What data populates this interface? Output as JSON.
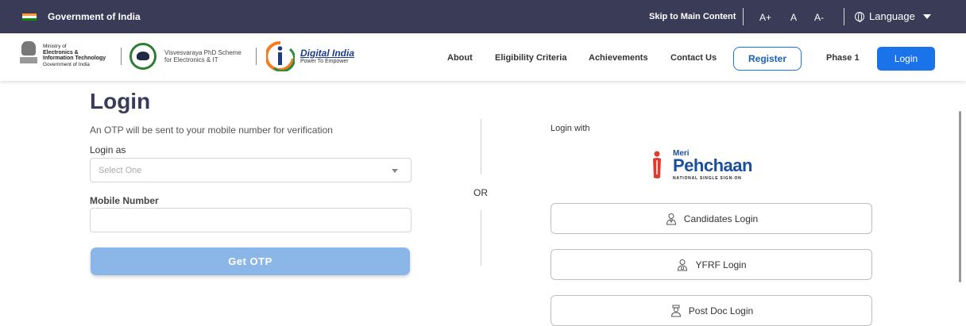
{
  "govbar": {
    "title": "Government of India",
    "skip": "Skip to Main Content",
    "font_plus": "A+",
    "font_normal": "A",
    "font_minus": "A-",
    "language": "Language"
  },
  "header": {
    "ministry_line1": "Ministry of",
    "ministry_line2": "Electronics &",
    "ministry_line3": "Information Technology",
    "ministry_line4": "Government of India",
    "scheme_line1": "Visvesvaraya PhD Scheme",
    "scheme_line2": "for Electronics & IT",
    "digital_title": "Digital India",
    "digital_tagline": "Power To Empower",
    "nav": [
      "About",
      "Eligibility Criteria",
      "Achievements",
      "Contact Us"
    ],
    "register": "Register",
    "phase": "Phase 1",
    "login": "Login"
  },
  "form": {
    "title": "Login",
    "otp_note": "An OTP will be sent to your mobile number for verification",
    "login_as_label": "Login as",
    "login_as_placeholder": "Select One",
    "mobile_label": "Mobile Number",
    "mobile_value": "",
    "get_otp": "Get OTP",
    "or": "OR"
  },
  "sso": {
    "login_with": "Login with",
    "brand_meri": "Meri",
    "brand_pehchaan": "Pehchaan",
    "brand_tagline": "NATIONAL SINGLE SIGN-ON",
    "buttons": [
      {
        "label": "Candidates Login",
        "icon": "candidate-icon"
      },
      {
        "label": "YFRF Login",
        "icon": "yfrf-icon"
      },
      {
        "label": "Post Doc Login",
        "icon": "postdoc-icon"
      }
    ]
  },
  "colors": {
    "topbar": "#3a3b57",
    "primary": "#1a73e8",
    "otp_button": "#8bb7e8",
    "brand_blue": "#1a4fa0"
  }
}
